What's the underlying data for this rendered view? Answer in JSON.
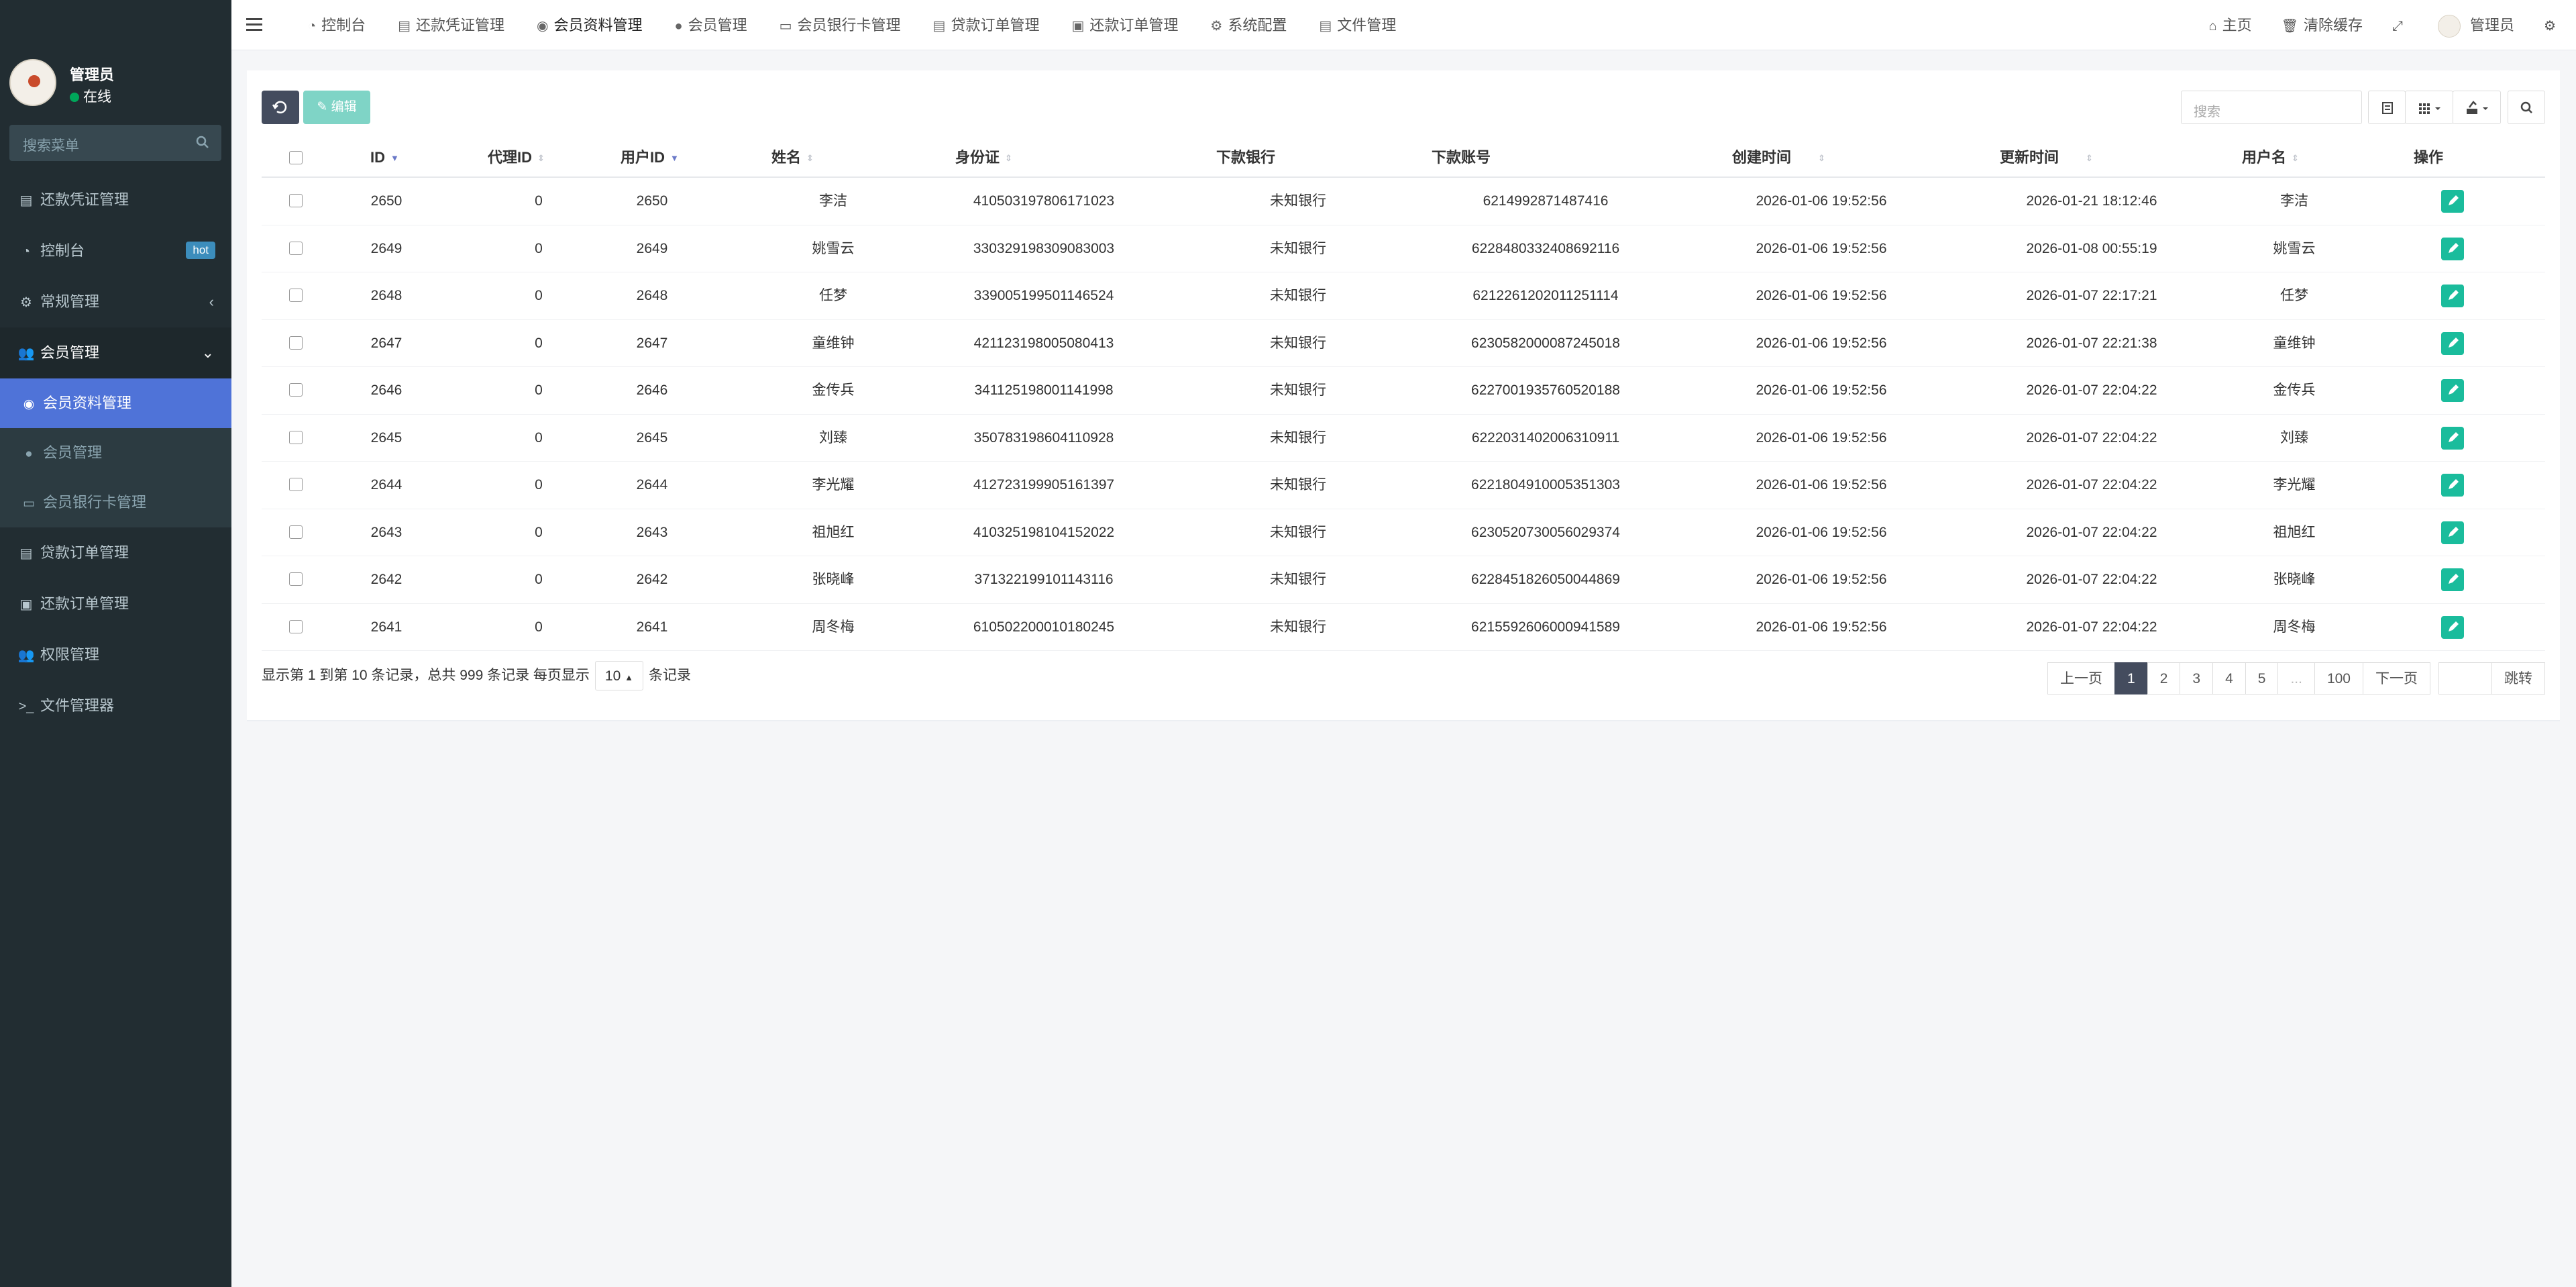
{
  "user": {
    "name": "管理员",
    "status": "在线"
  },
  "sidebar": {
    "search_placeholder": "搜索菜单",
    "items": [
      {
        "label": "还款凭证管理",
        "icon": "file-icon"
      },
      {
        "label": "控制台",
        "icon": "dashboard-icon",
        "badge": "hot"
      },
      {
        "label": "常规管理",
        "icon": "cogs-icon",
        "arrow": "‹"
      },
      {
        "label": "会员管理",
        "icon": "users-icon",
        "arrow": "⌄"
      }
    ],
    "submenu": [
      {
        "label": "会员资料管理",
        "icon": "user-circle-icon",
        "active": true
      },
      {
        "label": "会员管理",
        "icon": "user-icon"
      },
      {
        "label": "会员银行卡管理",
        "icon": "credit-card-icon"
      }
    ],
    "items_after": [
      {
        "label": "贷款订单管理",
        "icon": "file-icon"
      },
      {
        "label": "还款订单管理",
        "icon": "money-icon"
      },
      {
        "label": "权限管理",
        "icon": "group-icon"
      },
      {
        "label": "文件管理器",
        "icon": "terminal-icon"
      }
    ]
  },
  "topnav": {
    "tabs": [
      {
        "label": "控制台",
        "icon": "dashboard-icon"
      },
      {
        "label": "还款凭证管理",
        "icon": "file-icon"
      },
      {
        "label": "会员资料管理",
        "icon": "user-circle-icon"
      },
      {
        "label": "会员管理",
        "icon": "user-icon"
      },
      {
        "label": "会员银行卡管理",
        "icon": "credit-card-icon"
      },
      {
        "label": "贷款订单管理",
        "icon": "file-icon"
      },
      {
        "label": "还款订单管理",
        "icon": "money-icon"
      },
      {
        "label": "系统配置",
        "icon": "gear-icon"
      },
      {
        "label": "文件管理",
        "icon": "file-icon"
      }
    ],
    "home": "主页",
    "clear_cache": "清除缓存",
    "admin": "管理员"
  },
  "toolbar": {
    "edit_label": "编辑",
    "search_placeholder": "搜索"
  },
  "table": {
    "columns": [
      "ID",
      "代理ID",
      "用户ID",
      "姓名",
      "身份证",
      "下款银行",
      "下款账号",
      "创建时间",
      "更新时间",
      "用户名",
      "操作"
    ],
    "rows": [
      [
        "2650",
        "0",
        "2650",
        "李洁",
        "410503197806171023",
        "未知银行",
        "6214992871487416",
        "2026-01-06 19:52:56",
        "2026-01-21 18:12:46",
        "李洁"
      ],
      [
        "2649",
        "0",
        "2649",
        "姚雪云",
        "330329198309083003",
        "未知银行",
        "6228480332408692116",
        "2026-01-06 19:52:56",
        "2026-01-08 00:55:19",
        "姚雪云"
      ],
      [
        "2648",
        "0",
        "2648",
        "任梦",
        "339005199501146524",
        "未知银行",
        "6212261202011251114",
        "2026-01-06 19:52:56",
        "2026-01-07 22:17:21",
        "任梦"
      ],
      [
        "2647",
        "0",
        "2647",
        "童维钟",
        "421123198005080413",
        "未知银行",
        "6230582000087245018",
        "2026-01-06 19:52:56",
        "2026-01-07 22:21:38",
        "童维钟"
      ],
      [
        "2646",
        "0",
        "2646",
        "金传兵",
        "341125198001141998",
        "未知银行",
        "6227001935760520188",
        "2026-01-06 19:52:56",
        "2026-01-07 22:04:22",
        "金传兵"
      ],
      [
        "2645",
        "0",
        "2645",
        "刘臻",
        "350783198604110928",
        "未知银行",
        "6222031402006310911",
        "2026-01-06 19:52:56",
        "2026-01-07 22:04:22",
        "刘臻"
      ],
      [
        "2644",
        "0",
        "2644",
        "李光耀",
        "412723199905161397",
        "未知银行",
        "6221804910005351303",
        "2026-01-06 19:52:56",
        "2026-01-07 22:04:22",
        "李光耀"
      ],
      [
        "2643",
        "0",
        "2643",
        "祖旭红",
        "410325198104152022",
        "未知银行",
        "6230520730056029374",
        "2026-01-06 19:52:56",
        "2026-01-07 22:04:22",
        "祖旭红"
      ],
      [
        "2642",
        "0",
        "2642",
        "张晓峰",
        "371322199101143116",
        "未知银行",
        "6228451826050044869",
        "2026-01-06 19:52:56",
        "2026-01-07 22:04:22",
        "张晓峰"
      ],
      [
        "2641",
        "0",
        "2641",
        "周冬梅",
        "610502200010180245",
        "未知银行",
        "6215592606000941589",
        "2026-01-06 19:52:56",
        "2026-01-07 22:04:22",
        "周冬梅"
      ]
    ]
  },
  "footer": {
    "info_prefix": "显示第 1 到第 10 条记录，总共 999 条记录 每页显示",
    "page_size": "10",
    "info_suffix": "条记录",
    "pager": [
      "上一页",
      "1",
      "2",
      "3",
      "4",
      "5",
      "...",
      "100",
      "下一页"
    ],
    "jump": "跳转"
  }
}
